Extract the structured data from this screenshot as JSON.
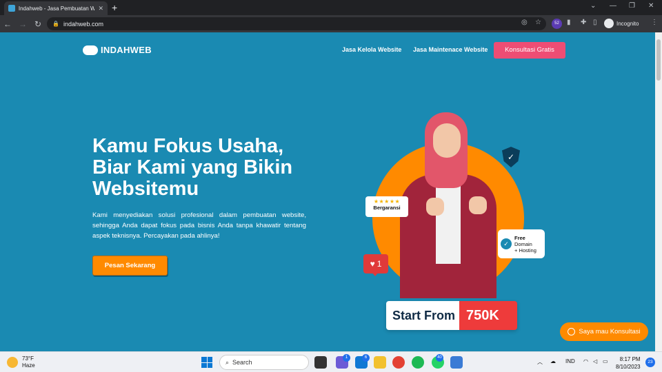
{
  "browser": {
    "tab_title": "Indahweb - Jasa Pembuatan Website",
    "tab_close": "✕",
    "new_tab": "+",
    "url": "indahweb.com",
    "extension_badge": "52",
    "profile_label": "Incognito"
  },
  "site": {
    "logo_text": "INDAHWEB",
    "nav": [
      {
        "label": "Jasa Kelola Website"
      },
      {
        "label": "Jasa Maintenace Website"
      }
    ],
    "cta_label": "Konsultasi Gratis",
    "hero": {
      "title_lines": [
        "Kamu Fokus Usaha,",
        "Biar Kami yang Bikin",
        "Websitemu"
      ],
      "description": "Kami menyediakan solusi profesional dalam pembuatan website, sehingga Anda dapat fokus pada bisnis Anda tanpa khawatir tentang aspek teknisnya. Percayakan pada ahlinya!",
      "order_button": "Pesan Sekarang"
    },
    "visual": {
      "stars": "★★★★★",
      "guarantee": "Bergaransi",
      "free_title": "Free",
      "free_line1": "Domain",
      "free_line2": "+ Hosting",
      "like_count": "1",
      "price_label": "Start From",
      "price_value": "750K"
    },
    "whatsapp_button": "Saya mau Konsultasi"
  },
  "taskbar": {
    "temperature": "73°F",
    "weather": "Haze",
    "search_label": "Search",
    "badges": [
      "1",
      "6",
      "40"
    ],
    "language": "IND",
    "time": "8:17 PM",
    "date": "8/10/2023",
    "notifications": "23"
  },
  "colors": {
    "hero_bg": "#1a8ab2",
    "cta_pink": "#ee4d74",
    "orange": "#ff8a00",
    "price_red": "#ee3b3b"
  }
}
